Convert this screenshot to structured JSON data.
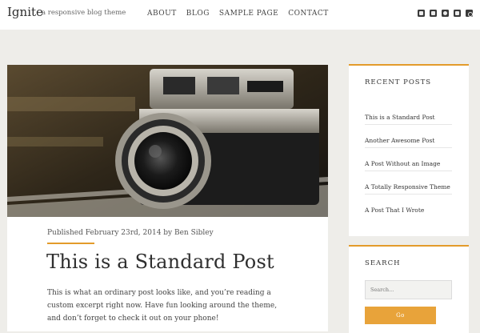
{
  "site": {
    "title": "Ignite",
    "tagline": "a responsive blog theme"
  },
  "nav": [
    "ABOUT",
    "BLOG",
    "SAMPLE PAGE",
    "CONTACT"
  ],
  "social_icons": [
    "twitter-icon",
    "facebook-icon",
    "pinterest-icon",
    "rss-icon",
    "instagram-icon"
  ],
  "post": {
    "meta": "Published February 23rd, 2014 by Ben Sibley",
    "title": "This is a Standard Post",
    "excerpt": "This is what an ordinary post looks like, and you’re reading a custom excerpt right now. Have fun looking around the theme, and don’t forget to check it out on your phone!"
  },
  "recent_posts": {
    "title": "RECENT POSTS",
    "items": [
      "This is a Standard Post",
      "Another Awesome Post",
      "A Post Without an Image",
      "A Totally Responsive Theme",
      "A Post That I Wrote"
    ]
  },
  "search": {
    "title": "SEARCH",
    "placeholder": "Search...",
    "button": "Go"
  },
  "colors": {
    "accent": "#e39b2b",
    "background": "#eeede9"
  }
}
